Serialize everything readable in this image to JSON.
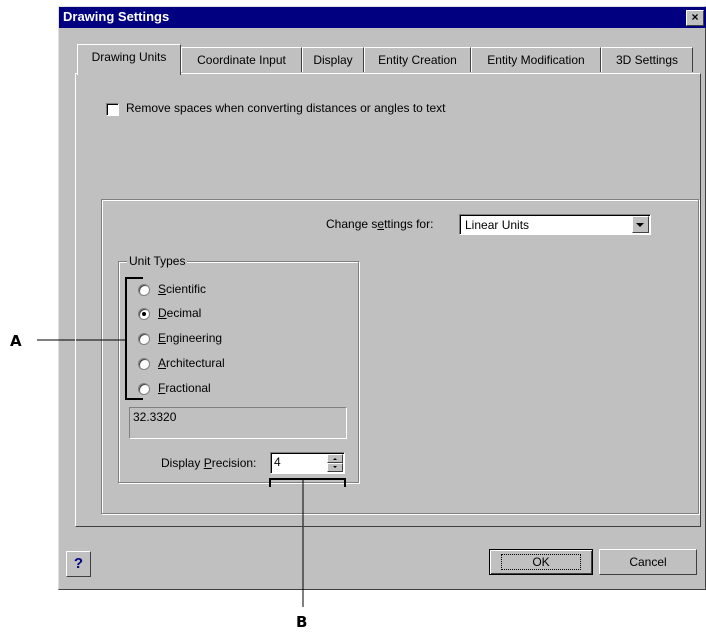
{
  "window": {
    "title": "Drawing Settings",
    "close_glyph": "×"
  },
  "tabs": [
    {
      "label": "Drawing Units",
      "active": true
    },
    {
      "label": "Coordinate Input"
    },
    {
      "label": "Display"
    },
    {
      "label": "Entity Creation"
    },
    {
      "label": "Entity Modification"
    },
    {
      "label": "3D Settings"
    }
  ],
  "options": {
    "remove_spaces_label": "Remove spaces when converting distances or angles to text",
    "remove_spaces_checked": false
  },
  "change_settings": {
    "label_prefix": "Change s",
    "label_hotkey": "e",
    "label_suffix": "ttings for:",
    "value": "Linear Units"
  },
  "unit_types": {
    "group_label": "Unit Types",
    "selected": "Decimal",
    "items": [
      {
        "hotkey": "S",
        "rest": "cientific"
      },
      {
        "hotkey": "D",
        "rest": "ecimal"
      },
      {
        "hotkey": "E",
        "rest": "ngineering"
      },
      {
        "hotkey": "A",
        "rest": "rchitectural"
      },
      {
        "hotkey": "F",
        "rest": "ractional"
      }
    ],
    "sample_value": "32.3320"
  },
  "precision": {
    "label_prefix": "Display ",
    "label_hotkey": "P",
    "label_suffix": "recision:",
    "value": "4"
  },
  "buttons": {
    "help": "?",
    "ok": "OK",
    "cancel": "Cancel"
  },
  "callouts": {
    "a": "A",
    "b": "B"
  },
  "colors": {
    "titlebar": "#000080",
    "face": "#c0c0c0",
    "help": "#000080"
  }
}
